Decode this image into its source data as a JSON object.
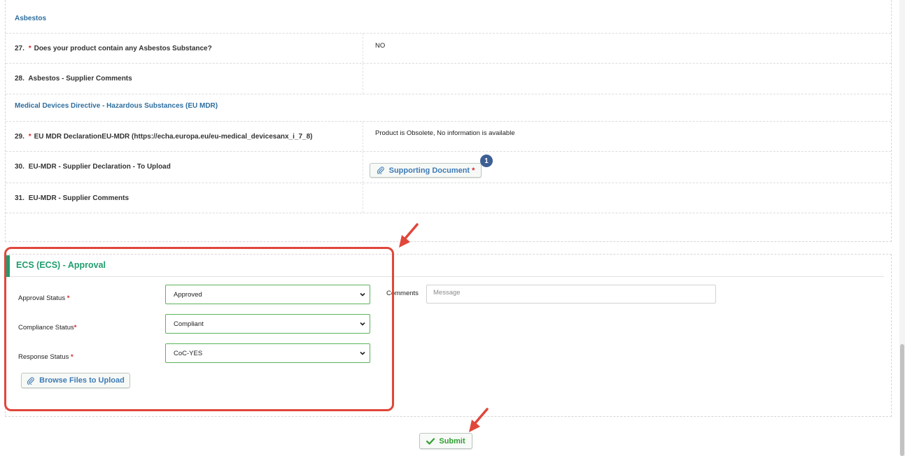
{
  "questionnaire": {
    "section_asbestos": "Asbestos",
    "q27": {
      "num": "27.",
      "required": "*",
      "label": "Does your product contain any Asbestos Substance?",
      "answer": "NO"
    },
    "q28": {
      "num": "28.",
      "label": "Asbestos - Supplier Comments"
    },
    "section_mdr": "Medical Devices Directive - Hazardous Substances (EU MDR)",
    "q29": {
      "num": "29.",
      "required": "*",
      "label": "EU MDR DeclarationEU-MDR (https://echa.europa.eu/eu-medical_devicesanx_i_7_8)",
      "answer": "Product is Obsolete, No information is available"
    },
    "q30": {
      "num": "30.",
      "label": "EU-MDR - Supplier Declaration - To Upload",
      "button": "Supporting Document",
      "button_required": "*",
      "badge_count": "1"
    },
    "q31": {
      "num": "31.",
      "label": "EU-MDR - Supplier Comments"
    }
  },
  "approval": {
    "title": "ECS (ECS) - Approval",
    "approval_status": {
      "label": "Approval Status",
      "required": "*",
      "value": "Approved"
    },
    "compliance_status": {
      "label": "Compliance Status",
      "required": "*",
      "value": "Compliant"
    },
    "response_status": {
      "label": "Response Status",
      "required": "*",
      "value": "CoC-YES"
    },
    "comments": {
      "label": "Comments",
      "placeholder": "Message"
    },
    "browse_button": "Browse Files to Upload"
  },
  "submit": {
    "label": "Submit"
  },
  "colors": {
    "accent_green": "#1f9d6d",
    "link_blue": "#2e6e9e",
    "required_red": "#d9242c",
    "annotation_red": "#e0463a",
    "submit_green": "#2e9f2e"
  },
  "icons": {
    "attach": "paperclip-icon",
    "select": "chevron-down-icon",
    "submit": "checkmark-icon",
    "badge": "count-badge"
  }
}
